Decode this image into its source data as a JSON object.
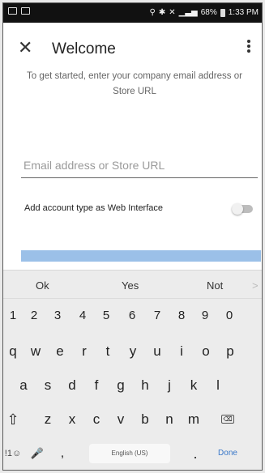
{
  "status_bar": {
    "battery": "68%",
    "time": "1:33 PM"
  },
  "header": {
    "close_icon": "✕",
    "title": "Welcome",
    "more_icon": "more-vertical"
  },
  "subtitle": "To get started, enter your company email address or Store URL",
  "email_input": {
    "placeholder": "Email address or Store URL",
    "value": ""
  },
  "web_interface_toggle": {
    "label": "Add account type as Web Interface",
    "on": false
  },
  "continue_button": {
    "label": "",
    "color": "#9bc0e8"
  },
  "keyboard": {
    "suggestions": [
      "Ok",
      "Yes",
      "Not"
    ],
    "suggestion_arrow": ">",
    "number_row": [
      "1",
      "2",
      "3",
      "4",
      "5",
      "6",
      "7",
      "8",
      "9",
      "0"
    ],
    "row1": [
      "q",
      "w",
      "e",
      "r",
      "t",
      "y",
      "u",
      "i",
      "o",
      "p"
    ],
    "row2": [
      "a",
      "s",
      "d",
      "f",
      "g",
      "h",
      "j",
      "k",
      "l"
    ],
    "row3": [
      "z",
      "x",
      "c",
      "v",
      "b",
      "n",
      "m"
    ],
    "shift_icon": "⇧",
    "backspace_icon": "⌫",
    "symbols_key": "!1☺",
    "mic_icon": "🎤",
    "comma_key": ",",
    "space_label": "English (US)",
    "period_key": ".",
    "done_label": "Done"
  }
}
